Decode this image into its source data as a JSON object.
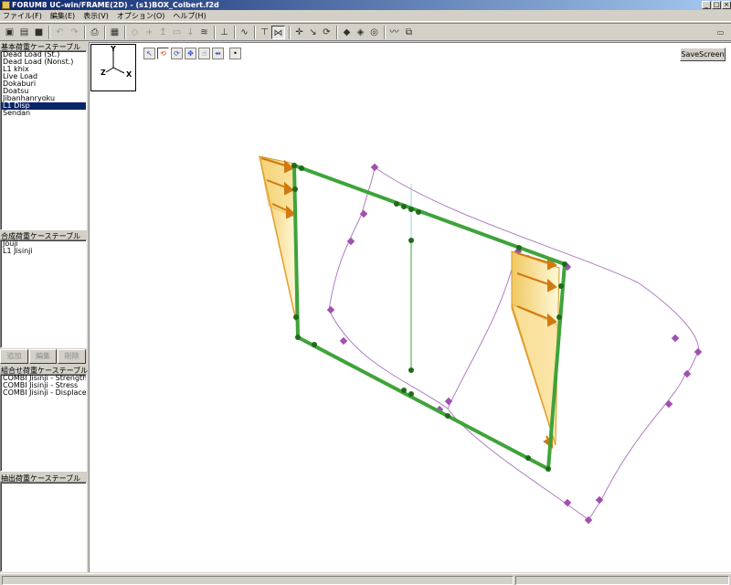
{
  "window": {
    "title": "FORUM8 UC-win/FRAME(2D) - (s1)BOX_Colbert.f2d",
    "controls": [
      "_",
      "□",
      "×"
    ]
  },
  "menu": [
    "ファイル(F)",
    "編集(E)",
    "表示(V)",
    "オプション(O)",
    "ヘルプ(H)"
  ],
  "basic_load": {
    "label": "基本荷重ケーステーブル",
    "items": [
      "Dead Load (St.)",
      "Dead Load (Nonst.)",
      "L1 khix",
      "Live Load",
      "Dokaburi",
      "Doatsu",
      "Jibanhanryoku",
      "L1 Disp",
      "Sendan"
    ],
    "selected_index": 7
  },
  "composite_load": {
    "label": "合成荷重ケーステーブル",
    "items": [
      "Jouji",
      "L1 Jisinji"
    ]
  },
  "buttons": {
    "add": "追加",
    "edit": "編集",
    "delete": "削除"
  },
  "combination_load": {
    "label": "組合せ荷重ケーステーブル",
    "items": [
      "COMBI Jisinji - Strength",
      "COMBI Jisinji - Stress",
      "COMBI Jisinji - Displacem"
    ]
  },
  "extract_load": {
    "label": "抽出荷重ケーステーブル",
    "items": []
  },
  "viewport": {
    "save_label": "SaveScreen",
    "axis": {
      "y": "Y",
      "x": "X",
      "z": "Z"
    }
  },
  "colors": {
    "member": "#3fa33a",
    "member_dark": "#1e6b1a",
    "deformed": "#a064b0",
    "load_fill": "#fde9a0",
    "load_arrow": "#e0901c",
    "title_bar": "#0a246a"
  }
}
